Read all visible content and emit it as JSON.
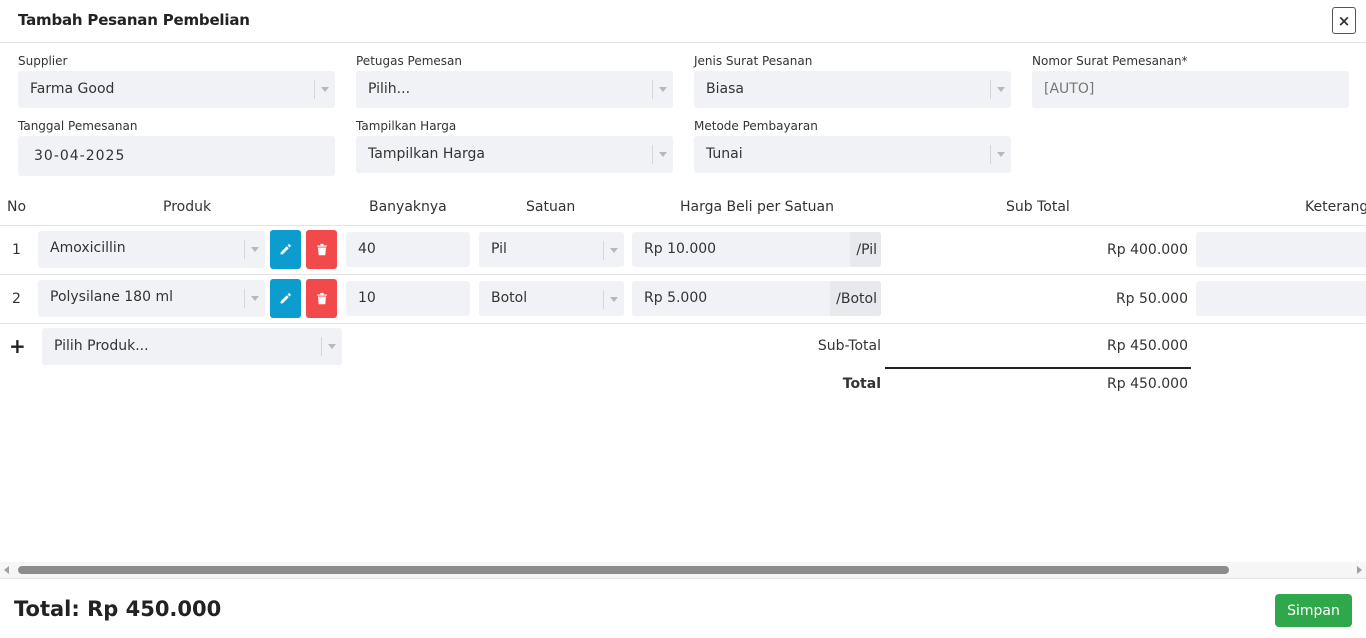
{
  "modal": {
    "title": "Tambah Pesanan Pembelian",
    "close_label": "×"
  },
  "form": {
    "supplier": {
      "label": "Supplier",
      "value": "Farma Good"
    },
    "petugas": {
      "label": "Petugas Pemesan",
      "value": "Pilih..."
    },
    "jenis_surat": {
      "label": "Jenis Surat Pesanan",
      "value": "Biasa"
    },
    "nomor_surat": {
      "label": "Nomor Surat Pemesanan*",
      "value": "[AUTO]"
    },
    "tanggal": {
      "label": "Tanggal Pemesanan",
      "value": "30-04-2025"
    },
    "tampilkan_harga": {
      "label": "Tampilkan Harga",
      "value": "Tampilkan Harga"
    },
    "metode_pembayaran": {
      "label": "Metode Pembayaran",
      "value": "Tunai"
    }
  },
  "table": {
    "headers": {
      "no": "No",
      "produk": "Produk",
      "banyaknya": "Banyaknya",
      "satuan": "Satuan",
      "harga": "Harga Beli per Satuan",
      "subtotal": "Sub Total",
      "keterangan": "Keterang"
    },
    "rows": [
      {
        "no": "1",
        "produk": "Amoxicillin",
        "banyaknya": "40",
        "satuan": "Pil",
        "harga": "Rp 10.000",
        "harga_suffix": "/Pil",
        "subtotal": "Rp 400.000"
      },
      {
        "no": "2",
        "produk": "Polysilane 180 ml",
        "banyaknya": "10",
        "satuan": "Botol",
        "harga": "Rp 5.000",
        "harga_suffix": "/Botol",
        "subtotal": "Rp 50.000"
      }
    ],
    "add_product": {
      "icon": "+",
      "placeholder": "Pilih Produk..."
    },
    "summary": {
      "subtotal_label": "Sub-Total",
      "subtotal_value": "Rp 450.000",
      "total_label": "Total",
      "total_value": "Rp 450.000"
    }
  },
  "footer": {
    "total_text": "Total: Rp 450.000",
    "save_label": "Simpan"
  },
  "colors": {
    "edit_button": "#0c9ccd",
    "delete_button": "#f24a4a",
    "save_button": "#2ea84a",
    "field_background": "#f1f2f5"
  },
  "icons": {
    "close": "close-icon",
    "edit": "pencil-icon",
    "delete": "trash-icon",
    "add": "plus-icon",
    "dropdown": "chevron-down-icon"
  }
}
